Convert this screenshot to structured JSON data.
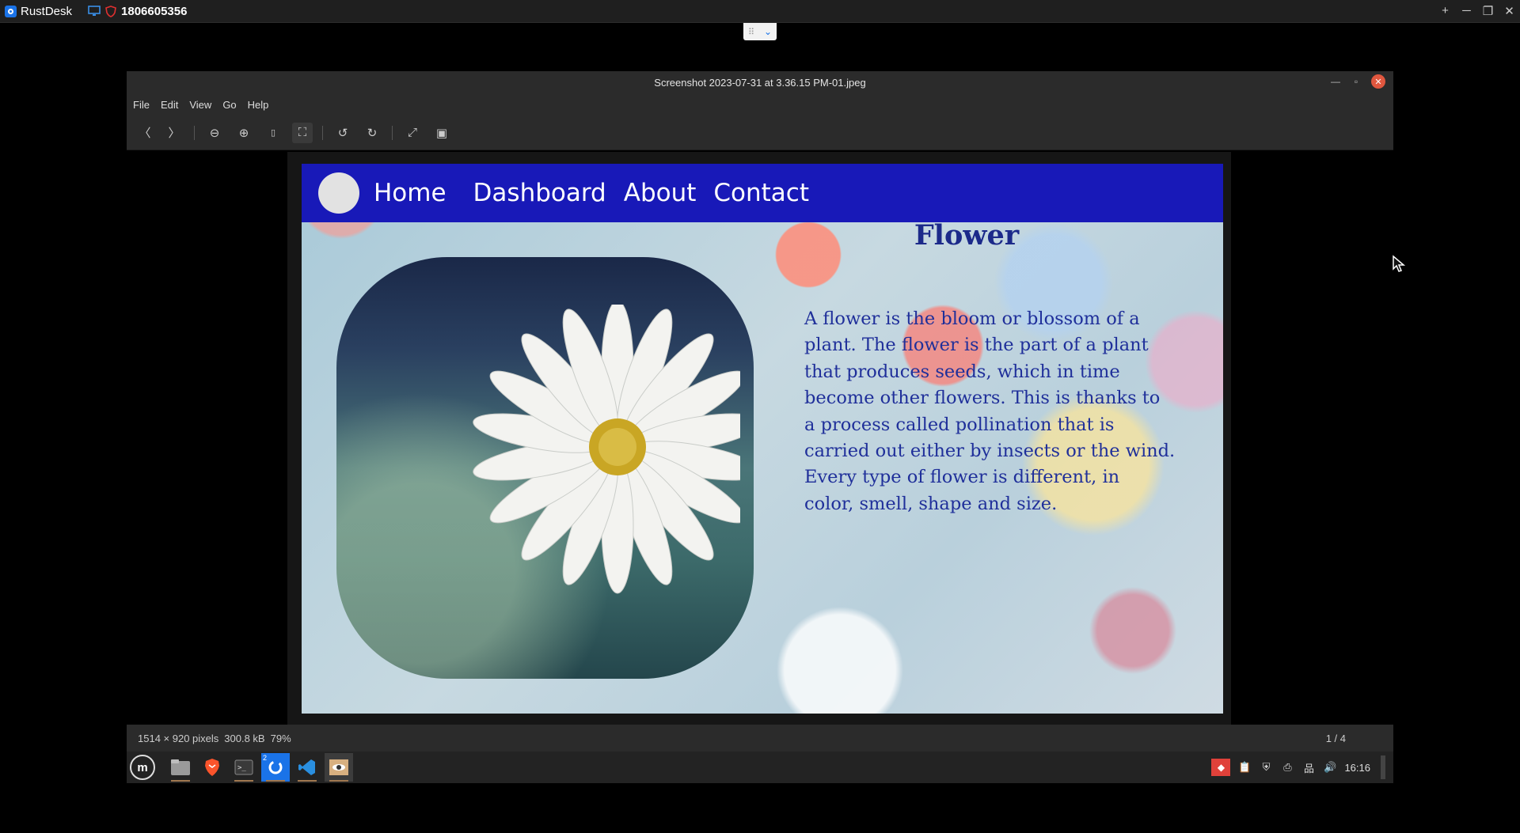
{
  "rustdesk": {
    "app_name": "RustDesk",
    "session_id": "1806605356",
    "controls": {
      "add": "+",
      "minimize": "─",
      "maximize": "❐",
      "close": "✕"
    }
  },
  "viewer": {
    "title": "Screenshot 2023-07-31 at 3.36.15 PM-01.jpeg",
    "menu": [
      "File",
      "Edit",
      "View",
      "Go",
      "Help"
    ],
    "toolbar_icons": [
      "prev-icon",
      "next-icon",
      "zoom-out-icon",
      "zoom-in-icon",
      "actual-size-icon",
      "best-fit-icon",
      "rotate-left-icon",
      "rotate-right-icon",
      "fullscreen-icon",
      "slideshow-icon"
    ],
    "status": {
      "dimensions": "1514 × 920 pixels",
      "filesize": "300.8 kB",
      "zoom": "79%",
      "counter": "1 / 4"
    }
  },
  "webpage": {
    "nav": [
      "Home",
      "Dashboard",
      "About",
      "Contact"
    ],
    "heading": "Flower",
    "paragraph_lines": [
      "A flower is the bloom or blossom of a",
      "plant. The flower is the part of a plant",
      "that produces seeds, which in time",
      "become other flowers. This is thanks to",
      "a process called pollination that is",
      "carried out either by insects or the wind.",
      "Every type of flower is different, in",
      "color, smell, shape and size."
    ],
    "colors": {
      "nav_bg": "#1819b8",
      "heading": "#1c2a8a",
      "text": "#1f2f9a"
    }
  },
  "taskbar": {
    "apps": [
      "files-icon",
      "brave-icon",
      "terminal-icon",
      "rustdesk-icon",
      "vscode-icon",
      "image-viewer-icon"
    ],
    "rustdesk_badge": "2",
    "clock": "16:16"
  }
}
